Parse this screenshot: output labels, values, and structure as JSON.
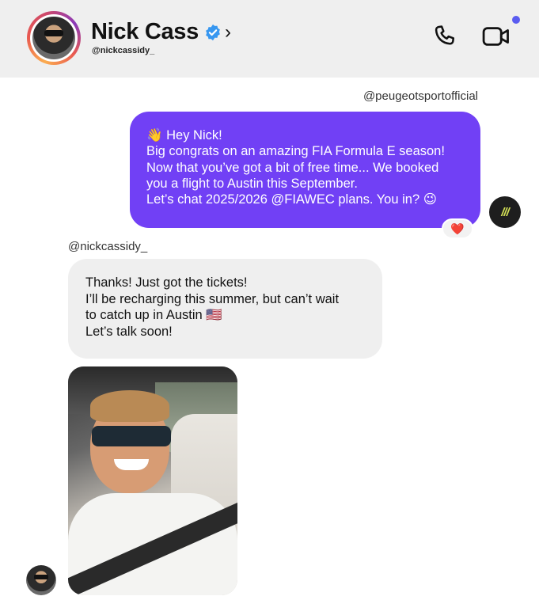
{
  "header": {
    "name": "Nick Cass",
    "handle": "@nickcassidy_",
    "chevron": "›",
    "verified_icon": "verified-badge-icon",
    "call_icon": "phone-icon",
    "video_icon": "video-camera-icon",
    "accent_dot_color": "#5a5cf0"
  },
  "messages": [
    {
      "sender": "@peugeotsportofficial",
      "direction": "outgoing",
      "bubble_color": "#7140f5",
      "lines": [
        "👋 Hey Nick!",
        "Big congrats on an amazing FIA Formula E season!",
        "Now that you’ve got a bit of free time... We booked",
        "you a flight to Austin this September.",
        "Let’s chat 2025/2026 @FIAWEC plans. You in? 😉"
      ],
      "reaction": "❤️",
      "avatar_text": "///"
    },
    {
      "sender": "@nickcassidy_",
      "direction": "incoming",
      "bubble_color": "#efefef",
      "lines": [
        "Thanks! Just got the tickets!",
        "I’ll be recharging this summer, but can’t wait",
        "to catch up in Austin 🇺🇸",
        "Let’s talk soon!"
      ]
    },
    {
      "sender": "@nickcassidy_",
      "direction": "incoming",
      "type": "photo",
      "photo_icon": "selfie-photo"
    }
  ]
}
